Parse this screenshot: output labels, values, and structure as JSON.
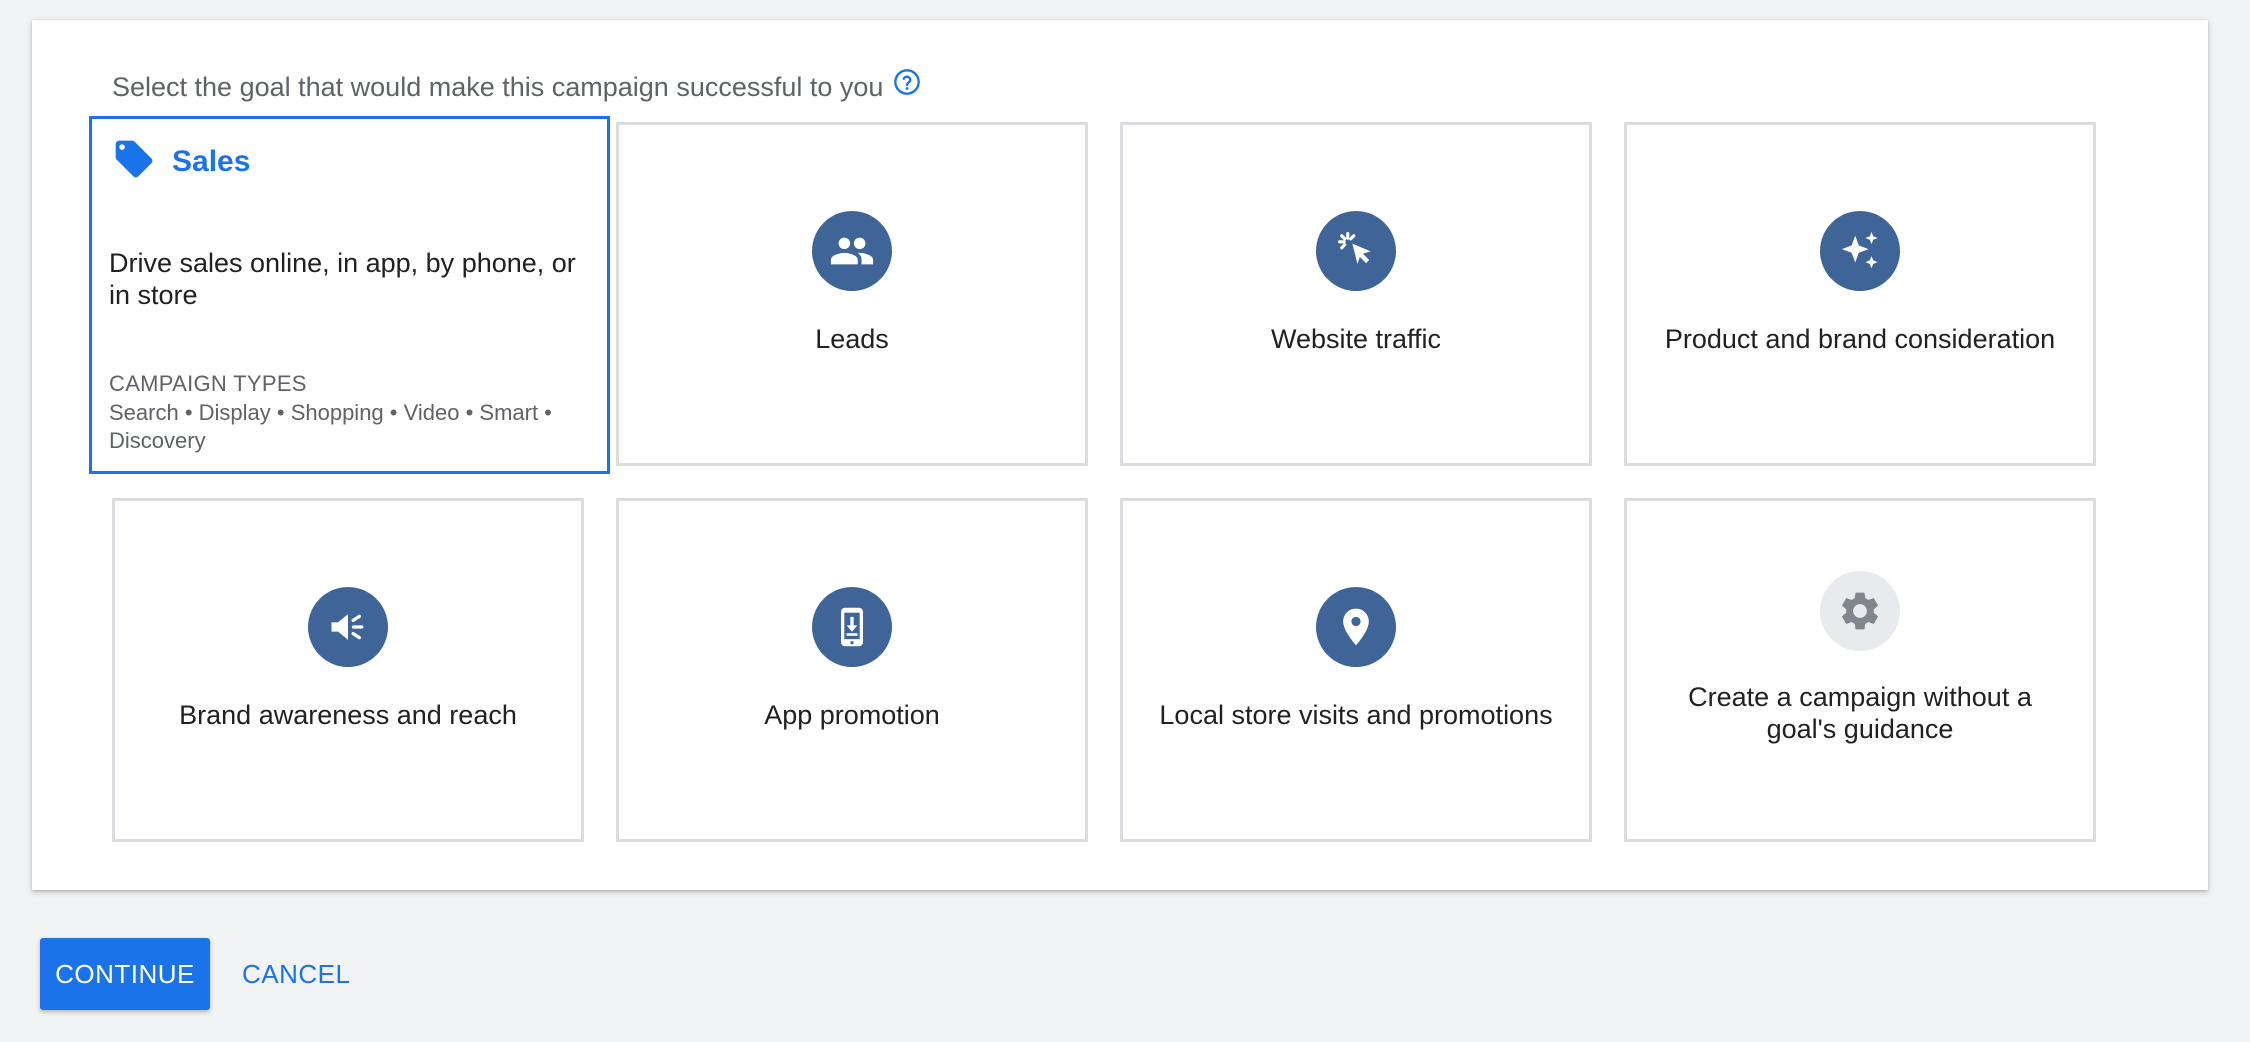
{
  "prompt": "Select the goal that would make this campaign successful to you",
  "help_icon": "help-circle-icon",
  "sales_card": {
    "title": "Sales",
    "icon": "tag-icon",
    "description": "Drive sales online, in app, by phone, or in store",
    "types_heading": "CAMPAIGN TYPES",
    "types_list": "Search • Display • Shopping • Video • Smart • Discovery"
  },
  "goals": [
    {
      "label": "Leads",
      "icon": "people-icon"
    },
    {
      "label": "Website traffic",
      "icon": "cursor-click-icon"
    },
    {
      "label": "Product and brand consideration",
      "icon": "sparkle-icon"
    },
    {
      "label": "Brand awareness and reach",
      "icon": "megaphone-icon"
    },
    {
      "label": "App promotion",
      "icon": "phone-download-icon"
    },
    {
      "label": "Local store visits and promotions",
      "icon": "location-pin-icon"
    },
    {
      "label": "Create a campaign without a goal's guidance",
      "icon": "gear-icon"
    }
  ],
  "actions": {
    "continue_label": "CONTINUE",
    "cancel_label": "CANCEL"
  },
  "colors": {
    "accent": "#1a73e8",
    "icon_circle": "#3f6598",
    "border": "#dadce0",
    "background": "#f1f3f4"
  }
}
